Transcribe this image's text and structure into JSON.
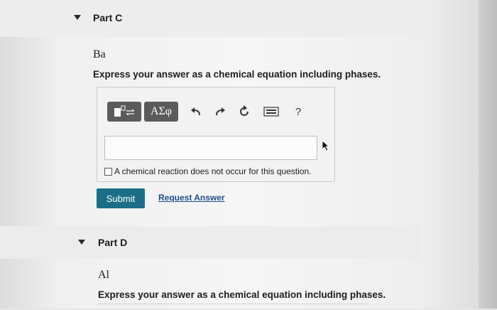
{
  "part_c": {
    "title": "Part C",
    "element": "Ba",
    "instruction": "Express your answer as a chemical equation including phases.",
    "toolbar": {
      "greek_label": "ΑΣφ",
      "help_label": "?"
    },
    "answer_value": "",
    "no_reaction_label": "A chemical reaction does not occur for this question.",
    "submit_label": "Submit",
    "request_answer_label": "Request Answer"
  },
  "part_d": {
    "title": "Part D",
    "element": "Al",
    "instruction": "Express your answer as a chemical equation including phases."
  },
  "colors": {
    "submit": "#1a6f86",
    "link": "#1c4e8a",
    "toolbar_button": "#5b5b5b"
  },
  "icons": [
    "caret-down-icon",
    "template-icon",
    "undo-icon",
    "redo-icon",
    "reset-icon",
    "keyboard-icon",
    "help-icon",
    "mouse-cursor-icon"
  ]
}
